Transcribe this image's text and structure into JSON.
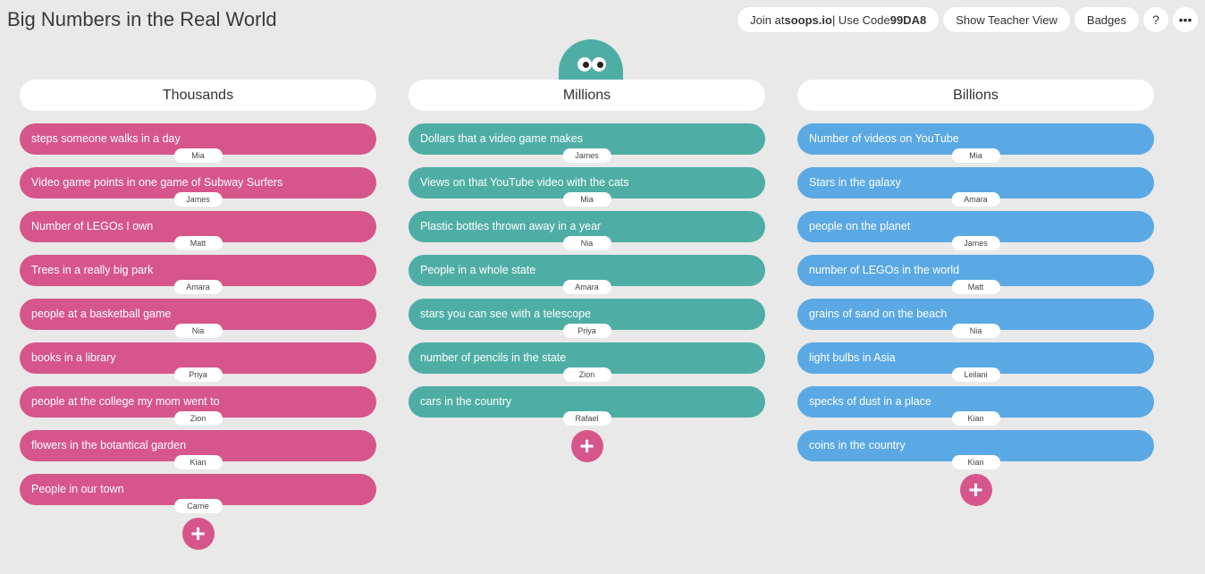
{
  "page": {
    "title": "Big Numbers in the Real World"
  },
  "topbar": {
    "join_prefix": "Join at ",
    "join_site": "soops.io",
    "join_mid": " | Use Code ",
    "join_code": "99DA8",
    "teacher_view": "Show Teacher View",
    "badges": "Badges",
    "help": "?",
    "more": "•••"
  },
  "add_label": "+",
  "colors": {
    "thousands": "#d6568a",
    "millions": "#4eaea6",
    "billions": "#5aa9e4",
    "add_button": "#d6568a"
  },
  "columns": [
    {
      "title": "Thousands",
      "cards": [
        {
          "text": "steps someone walks in a day",
          "author": "Mia"
        },
        {
          "text": "Video game points in one game of Subway Surfers",
          "author": "James"
        },
        {
          "text": "Number of LEGOs I own",
          "author": "Matt"
        },
        {
          "text": "Trees in a really big park",
          "author": "Amara"
        },
        {
          "text": "people at a basketball game",
          "author": "Nia"
        },
        {
          "text": "books in a library",
          "author": "Priya"
        },
        {
          "text": "people at the college my mom went to",
          "author": "Zion"
        },
        {
          "text": "flowers in the botantical garden",
          "author": "Kian"
        },
        {
          "text": "People in our town",
          "author": "Carrie"
        }
      ]
    },
    {
      "title": "Millions",
      "cards": [
        {
          "text": "Dollars that a video game makes",
          "author": "James"
        },
        {
          "text": "Views on that YouTube video with the cats",
          "author": "Mia"
        },
        {
          "text": "Plastic bottles thrown away in a year",
          "author": "Nia"
        },
        {
          "text": "People in a whole state",
          "author": "Amara"
        },
        {
          "text": "stars you can see with a telescope",
          "author": "Priya"
        },
        {
          "text": "number of pencils in the state",
          "author": "Zion"
        },
        {
          "text": "cars in the country",
          "author": "Rafael"
        }
      ]
    },
    {
      "title": "Billions",
      "cards": [
        {
          "text": "Number of videos on YouTube",
          "author": "Mia"
        },
        {
          "text": "Stars in the galaxy",
          "author": "Amara"
        },
        {
          "text": "people on the planet",
          "author": "James"
        },
        {
          "text": "number of LEGOs in the world",
          "author": "Matt"
        },
        {
          "text": "grains of sand on the beach",
          "author": "Nia"
        },
        {
          "text": "light bulbs in Asia",
          "author": "Leilani"
        },
        {
          "text": "specks of dust in a place",
          "author": "Kian"
        },
        {
          "text": "coins in the country",
          "author": "Kian"
        }
      ]
    }
  ]
}
